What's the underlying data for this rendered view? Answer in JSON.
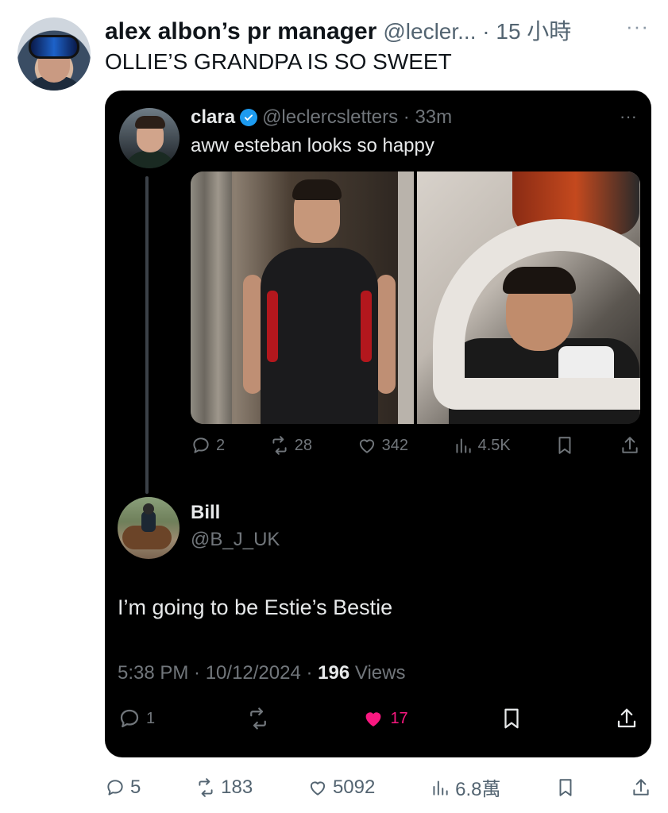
{
  "outer_tweet": {
    "display_name": "alex albon’s pr manager",
    "handle_time": "@lecler... · 15 小時",
    "text": "OLLIE’S GRANDPA IS SO SWEET",
    "more": "···",
    "actions": {
      "replies": "5",
      "reposts": "183",
      "likes": "5092",
      "views": "6.8萬"
    }
  },
  "quoted_tweet": {
    "display_name": "clara",
    "handle_time": "@leclercsletters · 33m",
    "text": "aww esteban looks so happy",
    "more": "···",
    "actions": {
      "replies": "2",
      "reposts": "28",
      "likes": "342",
      "views": "4.5K"
    }
  },
  "reply": {
    "display_name": "Bill",
    "handle": "@B_J_UK",
    "text": "I’m going to be Estie’s Bestie",
    "timestamp": "5:38 PM · 10/12/2024 · ",
    "views_count": "196",
    "views_label": " Views",
    "actions": {
      "replies": "1",
      "likes": "17"
    }
  },
  "colors": {
    "like_active": "#f91880",
    "verified": "#1d9bf0",
    "card_bg": "#000000"
  }
}
